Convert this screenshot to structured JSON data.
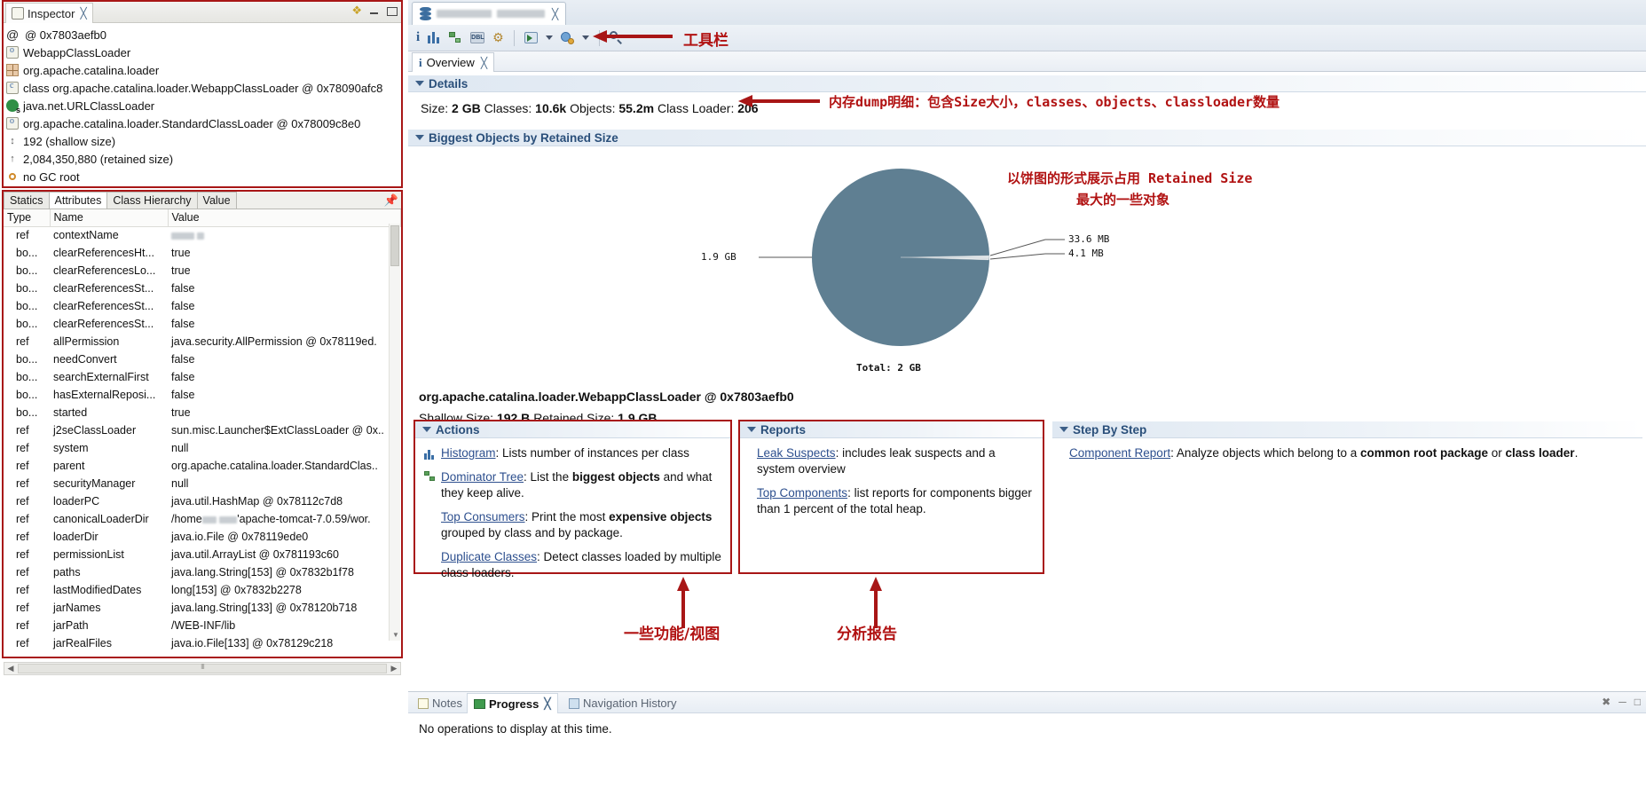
{
  "inspector": {
    "tab_label": "Inspector",
    "tab_close": "╳",
    "rows": [
      {
        "icon": "at-icon",
        "text": "@ 0x7803aefb0"
      },
      {
        "icon": "object-icon",
        "text": "WebappClassLoader"
      },
      {
        "icon": "package-icon",
        "text": "org.apache.catalina.loader"
      },
      {
        "icon": "class-icon",
        "text": "class org.apache.catalina.loader.WebappClassLoader @ 0x78090afc8"
      },
      {
        "icon": "superclass-icon",
        "text": "java.net.URLClassLoader"
      },
      {
        "icon": "object-icon",
        "text": "org.apache.catalina.loader.StandardClassLoader @ 0x78009c8e0"
      },
      {
        "icon": "shallow-size-icon",
        "text": "192 (shallow size)"
      },
      {
        "icon": "retained-size-icon",
        "text": "2,084,350,880 (retained size)"
      },
      {
        "icon": "gc-root-icon",
        "text": "no GC root"
      }
    ]
  },
  "attributes": {
    "tabs": [
      {
        "label": "Statics",
        "active": false
      },
      {
        "label": "Attributes",
        "active": true
      },
      {
        "label": "Class Hierarchy",
        "active": false
      },
      {
        "label": "Value",
        "active": false
      }
    ],
    "columns": [
      "Type",
      "Name",
      "Value"
    ],
    "rows": [
      {
        "type": "ref",
        "name": "contextName",
        "value": "",
        "redacted": true
      },
      {
        "type": "bo...",
        "name": "clearReferencesHt...",
        "value": "true"
      },
      {
        "type": "bo...",
        "name": "clearReferencesLo...",
        "value": "true"
      },
      {
        "type": "bo...",
        "name": "clearReferencesSt...",
        "value": "false"
      },
      {
        "type": "bo...",
        "name": "clearReferencesSt...",
        "value": "false"
      },
      {
        "type": "bo...",
        "name": "clearReferencesSt...",
        "value": "false"
      },
      {
        "type": "ref",
        "name": "allPermission",
        "value": "java.security.AllPermission @ 0x78119ed."
      },
      {
        "type": "bo...",
        "name": "needConvert",
        "value": "false"
      },
      {
        "type": "bo...",
        "name": "searchExternalFirst",
        "value": "false"
      },
      {
        "type": "bo...",
        "name": "hasExternalReposi...",
        "value": "false"
      },
      {
        "type": "bo...",
        "name": "started",
        "value": "true"
      },
      {
        "type": "ref",
        "name": "j2seClassLoader",
        "value": "sun.misc.Launcher$ExtClassLoader @ 0x.."
      },
      {
        "type": "ref",
        "name": "system",
        "value": "null"
      },
      {
        "type": "ref",
        "name": "parent",
        "value": "org.apache.catalina.loader.StandardClas.."
      },
      {
        "type": "ref",
        "name": "securityManager",
        "value": "null"
      },
      {
        "type": "ref",
        "name": "loaderPC",
        "value": "java.util.HashMap @ 0x78112c7d8"
      },
      {
        "type": "ref",
        "name": "canonicalLoaderDir",
        "value": "/home,   'apache-tomcat-7.0.59/wor.",
        "redacted_mid": true
      },
      {
        "type": "ref",
        "name": "loaderDir",
        "value": "java.io.File @ 0x78119ede0"
      },
      {
        "type": "ref",
        "name": "permissionList",
        "value": "java.util.ArrayList @ 0x781193c60"
      },
      {
        "type": "ref",
        "name": "paths",
        "value": "java.lang.String[153] @ 0x7832b1f78"
      },
      {
        "type": "ref",
        "name": "lastModifiedDates",
        "value": "long[153] @ 0x7832b2278"
      },
      {
        "type": "ref",
        "name": "jarNames",
        "value": "java.lang.String[133] @ 0x78120b718"
      },
      {
        "type": "ref",
        "name": "jarPath",
        "value": "/WEB-INF/lib"
      },
      {
        "type": "ref",
        "name": "jarRealFiles",
        "value": "java.io.File[133] @ 0x78129c218"
      }
    ]
  },
  "editor": {
    "tab_label": "",
    "tab_redacted": true,
    "tab_close": "╳",
    "toolbar": {
      "icons": [
        "inspector-info-icon",
        "histogram-icon",
        "dominator-tree-icon",
        "oql-icon",
        "settings-icon",
        "open-query-browser-icon",
        "calculate-retained-icon",
        "search-icon"
      ]
    },
    "subtab": {
      "label": "Overview",
      "close": "╳",
      "icon": "info-icon"
    },
    "details": {
      "section_title": "Details",
      "size_label": "Size:",
      "size_value": "2 GB",
      "classes_label": "Classes:",
      "classes_value": "10.6k",
      "objects_label": "Objects:",
      "objects_value": "55.2m",
      "classloader_label": "Class Loader:",
      "classloader_value": "206"
    },
    "biggest": {
      "section_title": "Biggest Objects by Retained Size",
      "object_title": "org.apache.catalina.loader.WebappClassLoader @ 0x7803aefb0",
      "shallow_label": "Shallow Size:",
      "shallow_value": "192 B",
      "retained_label": "Retained Size:",
      "retained_value": "1.9 GB"
    },
    "actions": {
      "title": "Actions",
      "items": [
        {
          "icon": "histogram-icon",
          "link": "Histogram",
          "rest_before": ": Lists number of instances per class",
          "bold": "",
          "rest_after": ""
        },
        {
          "icon": "dominator-tree-icon",
          "link": "Dominator Tree",
          "rest_before": ": List the ",
          "bold": "biggest objects",
          "rest_after": " and what they keep alive."
        },
        {
          "icon": "",
          "link": "Top Consumers",
          "rest_before": ": Print the most ",
          "bold": "expensive objects",
          "rest_after": " grouped by class and by package."
        },
        {
          "icon": "",
          "link": "Duplicate Classes",
          "rest_before": ": Detect classes loaded by multiple class loaders.",
          "bold": "",
          "rest_after": ""
        }
      ]
    },
    "reports": {
      "title": "Reports",
      "items": [
        {
          "link": "Leak Suspects",
          "rest_before": ": includes leak suspects and a system overview",
          "bold": "",
          "rest_after": ""
        },
        {
          "link": "Top Components",
          "rest_before": ": list reports for components bigger than 1 percent of the total heap.",
          "bold": "",
          "rest_after": ""
        }
      ]
    },
    "stepbystep": {
      "title": "Step By Step",
      "items": [
        {
          "link": "Component Report",
          "rest_before": ": Analyze objects which belong to a ",
          "bold": "common root package",
          "mid": " or ",
          "bold2": "class loader",
          "rest_after": "."
        }
      ]
    }
  },
  "bottom_view": {
    "tabs": [
      {
        "label": "Notes",
        "icon": "notes-icon",
        "active": false
      },
      {
        "label": "Progress",
        "icon": "progress-icon",
        "active": true
      },
      {
        "label": "Navigation History",
        "icon": "nav-icon",
        "active": false
      }
    ],
    "close": "╳",
    "message": "No operations to display at this time.",
    "tools": [
      "clear-icon",
      "minimize-icon",
      "maximize-icon"
    ]
  },
  "annotations": [
    {
      "id": "toolbar",
      "text": "工具栏"
    },
    {
      "id": "details",
      "text": "内存dump明细：包含Size大小，classes、objects、classloader数量"
    },
    {
      "id": "pie-1",
      "text": "以饼图的形式展示占用 Retained Size"
    },
    {
      "id": "pie-2",
      "text": "最大的一些对象"
    },
    {
      "id": "actions",
      "text": "一些功能/视图"
    },
    {
      "id": "reports",
      "text": "分析报告"
    }
  ],
  "colors": {
    "annotation_red": "#b11212",
    "box_red": "#a81616",
    "pie_slice": "#5f7f92",
    "pie_small": "#e9edef",
    "link_blue": "#2d4f8e",
    "section_blue": "#2a4f7a"
  },
  "chart_data": {
    "type": "pie",
    "title": "Biggest Objects by Retained Size",
    "total_label": "Total: 2 GB",
    "total_value": "2 GB",
    "labels": [
      "1.9 GB",
      "33.6 MB",
      "4.1 MB"
    ],
    "values": [
      1945.6,
      33.6,
      4.1
    ],
    "unit": "MB",
    "legend": "none",
    "grid": false,
    "slice_colors": [
      "#5f7f92",
      "#e3e8ea",
      "#f2f4f5"
    ]
  }
}
